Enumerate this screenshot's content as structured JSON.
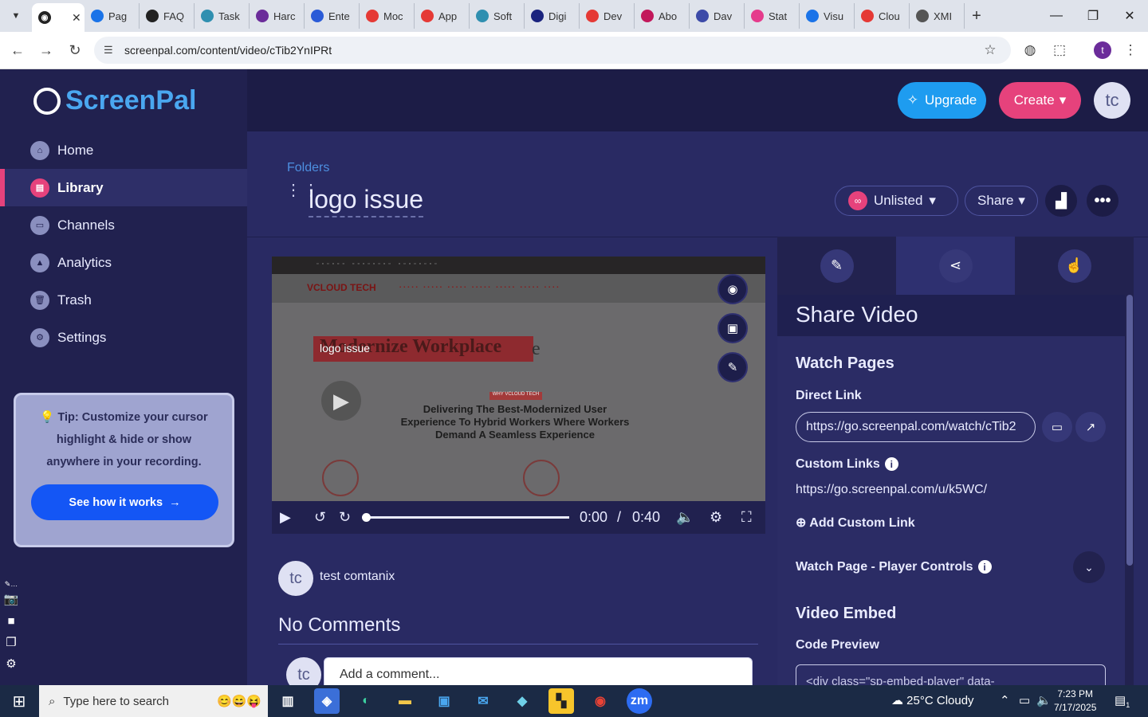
{
  "browser": {
    "tabs": [
      {
        "label": "",
        "active": true,
        "color": "#222"
      },
      {
        "label": "Pag",
        "color": "#1a73e8"
      },
      {
        "label": "FAQ",
        "color": "#222"
      },
      {
        "label": "Task",
        "color": "#2f8fb0"
      },
      {
        "label": "Harc",
        "color": "#6b2c9a"
      },
      {
        "label": "Ente",
        "color": "#2a5bd7"
      },
      {
        "label": "Moc",
        "color": "#e53935"
      },
      {
        "label": "App",
        "color": "#e53935"
      },
      {
        "label": "Soft",
        "color": "#2f8fb0"
      },
      {
        "label": "Digi",
        "color": "#1a237e"
      },
      {
        "label": "Dev",
        "color": "#e53935"
      },
      {
        "label": "Abo",
        "color": "#c2185b"
      },
      {
        "label": "Dav",
        "color": "#3c4aa8"
      },
      {
        "label": "Stat",
        "color": "#e53b8c"
      },
      {
        "label": "Visu",
        "color": "#1a73e8"
      },
      {
        "label": "Clou",
        "color": "#e53935"
      },
      {
        "label": "XMI",
        "color": "#555"
      }
    ],
    "url": "screenpal.com/content/video/cTib2YnIPRt"
  },
  "sidebar": {
    "logo": "ScreenPal",
    "items": [
      {
        "label": "Home"
      },
      {
        "label": "Library",
        "active": true
      },
      {
        "label": "Channels"
      },
      {
        "label": "Analytics"
      },
      {
        "label": "Trash"
      },
      {
        "label": "Settings"
      }
    ],
    "tip": {
      "text": "💡 Tip: Customize your cursor highlight & hide or show anywhere in your recording.",
      "button": "See how it works"
    }
  },
  "header": {
    "upgrade": "Upgrade",
    "create": "Create",
    "avatar": "tc"
  },
  "video_page": {
    "breadcrumb": "Folders",
    "title": "logo issue",
    "visibility": "Unlisted",
    "share": "Share",
    "player": {
      "label": "logo issue",
      "current_time": "0:00",
      "separator": "/",
      "duration": "0:40",
      "progress": 0
    },
    "frame": {
      "brand": "VCLOUD TECH",
      "hero": "Modernize Workplace",
      "hero_tail": "e",
      "badge": "WHY VCLOUD TECH",
      "headline": "Delivering The Best-Modernized User Experience To Hybrid Workers Where Workers Demand A Seamless Experience"
    },
    "owner": {
      "avatar": "tc",
      "name": "test comtanix"
    },
    "comments": {
      "heading": "No Comments",
      "avatar": "tc",
      "placeholder": "Add a comment..."
    }
  },
  "share_panel": {
    "heading": "Share Video",
    "watch_pages": "Watch Pages",
    "direct_link_label": "Direct Link",
    "direct_link": "https://go.screenpal.com/watch/cTib2",
    "custom_links_label": "Custom Links",
    "custom_link": "https://go.screenpal.com/u/k5WC/",
    "add_custom_link": "Add Custom Link",
    "player_controls": "Watch Page - Player Controls",
    "video_embed": "Video Embed",
    "code_preview_label": "Code Preview",
    "code_preview": "<div class=\"sp-embed-player\" data-"
  },
  "taskbar": {
    "search_placeholder": "Type here to search",
    "weather": "25°C  Cloudy",
    "time": "7:23 PM",
    "date": "7/17/2025",
    "notifications": "1"
  },
  "colors": {
    "brand_pink": "#e6427c",
    "brand_blue": "#1e9cf0",
    "sidebar_bg": "#21214f",
    "content_bg": "#292a63"
  }
}
